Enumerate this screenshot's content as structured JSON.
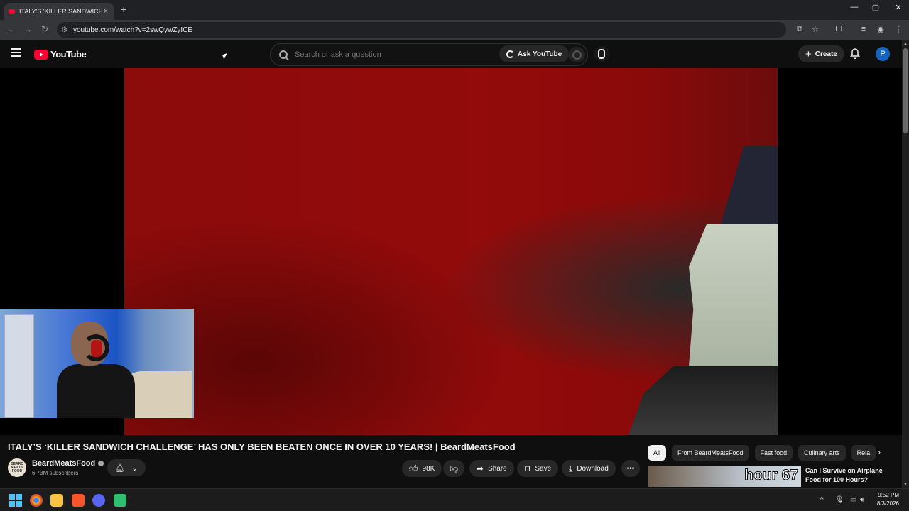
{
  "browser": {
    "tab_title": "ITALY'S 'KILLER SANDWICH CH...",
    "tab_close": "×",
    "new_tab": "+",
    "url": "youtube.com/watch?v=2swQywZyICE",
    "min": "—",
    "max": "▢",
    "close": "✕"
  },
  "youtube": {
    "logo_text": "YouTube",
    "search_placeholder": "Search or ask a question",
    "ask_label": "Ask YouTube",
    "create_label": "Create",
    "avatar_letter": "P"
  },
  "video": {
    "title": "ITALY’S ‘KILLER SANDWICH CHALLENGE’ HAS ONLY BEEN BEATEN ONCE IN OVER 10 YEARS! | BeardMeatsFood",
    "channel_name": "BeardMeatsFood",
    "channel_avatar_text": "BEARD MEATS FOOD",
    "subscribers": "6.73M subscribers",
    "likes": "98K",
    "share_label": "Share",
    "save_label": "Save",
    "download_label": "Download",
    "more_label": "•••"
  },
  "chips": [
    "All",
    "From BeardMeatsFood",
    "Fast food",
    "Culinary arts",
    "Rela"
  ],
  "recommended": {
    "thumb_text": "hour 67",
    "title": "Can I Survive on Airplane Food for 100 Hours?"
  },
  "taskbar": {
    "time": "9:52 PM",
    "date": "8/3/2026"
  },
  "colors": {
    "youtube_red": "#ff0033",
    "video_red": "#930b0b",
    "avatar_blue": "#1565c0"
  }
}
